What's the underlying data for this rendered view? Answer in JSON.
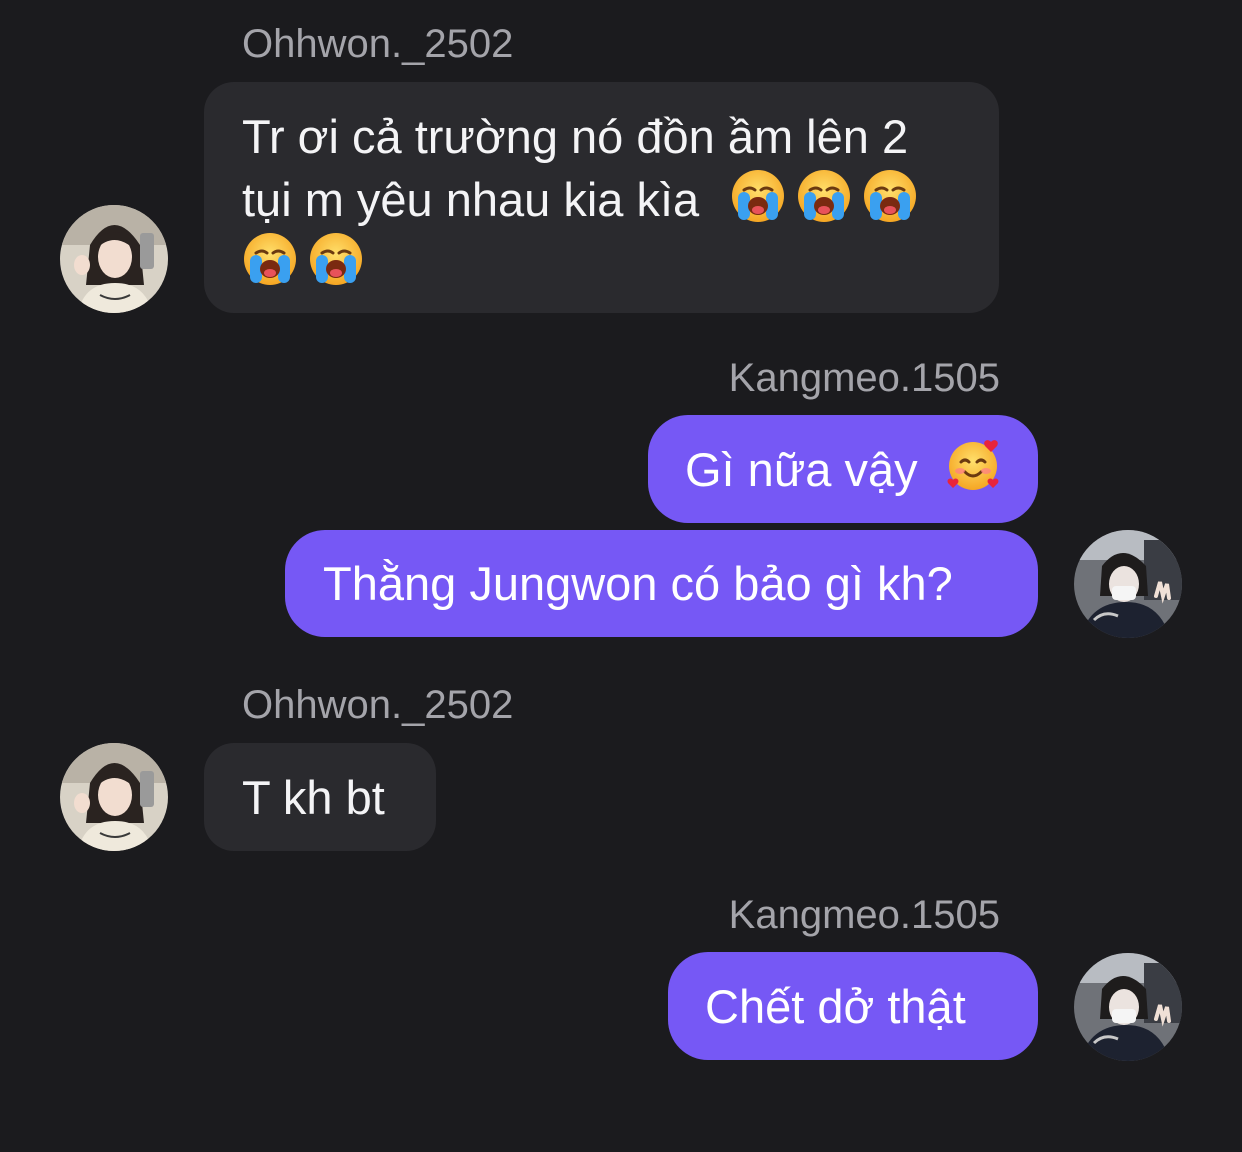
{
  "messages": [
    {
      "sender": "Ohhwon._2502",
      "lines": [
        "Tr ơi cả trường nó đồn ầm lên 2",
        "tụi m yêu nhau kia kìa"
      ],
      "emoji": "loudly-crying-face"
    },
    {
      "sender": "Kangmeo.1505",
      "text": "Gì nữa vậy",
      "emoji": "smiling-face-with-hearts"
    },
    {
      "text": "Thằng Jungwon có bảo gì kh?"
    },
    {
      "sender": "Ohhwon._2502",
      "text": "T kh bt"
    },
    {
      "sender": "Kangmeo.1505",
      "text": "Chết dở thật"
    }
  ],
  "colors": {
    "background": "#1b1b1e",
    "incoming_bubble": "#2a2a2e",
    "outgoing_bubble": "#7658f5",
    "sender_name": "#a4a4aa",
    "text": "#ffffff"
  }
}
